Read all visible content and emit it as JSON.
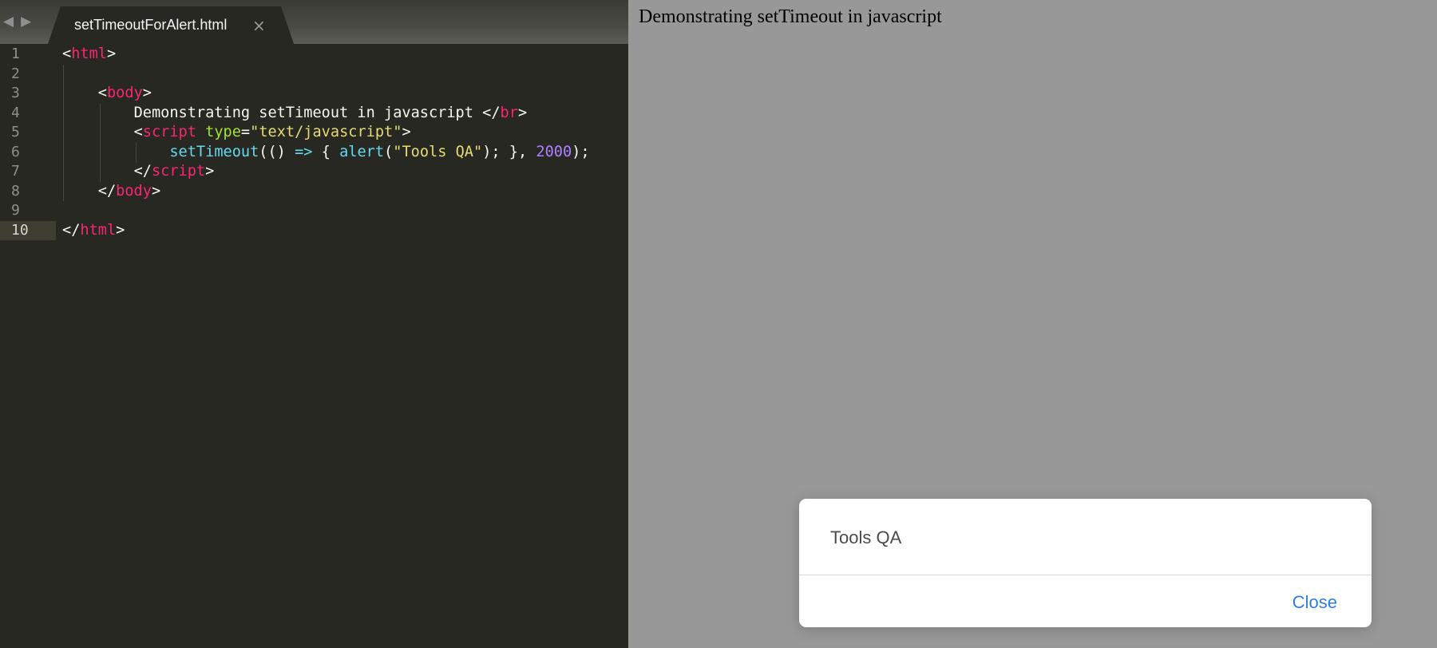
{
  "editor": {
    "nav": {
      "back_icon": "◀",
      "forward_icon": "▶"
    },
    "tab": {
      "title": "setTimeoutForAlert.html",
      "close_icon": "×"
    },
    "line_numbers": [
      "1",
      "2",
      "3",
      "4",
      "5",
      "6",
      "7",
      "8",
      "9",
      "10"
    ],
    "active_line": "10",
    "code": {
      "l1_open": "<",
      "l1_tag": "html",
      "l1_close": ">",
      "l3_indent": "    ",
      "l3_open": "<",
      "l3_tag": "body",
      "l3_close": ">",
      "l4_indent": "        ",
      "l4_text": "Demonstrating setTimeout in javascript ",
      "l4_open": "</",
      "l4_tag": "br",
      "l4_close": ">",
      "l5_indent": "        ",
      "l5_open": "<",
      "l5_tag": "script",
      "l5_sp": " ",
      "l5_attr": "type",
      "l5_eq": "=",
      "l5_str": "\"text/javascript\"",
      "l5_close": ">",
      "l6_indent": "            ",
      "l6_fn": "setTimeout",
      "l6_p1": "(() ",
      "l6_arrow": "=>",
      "l6_p2": " { ",
      "l6_fn2": "alert",
      "l6_p3": "(",
      "l6_str": "\"Tools QA\"",
      "l6_p4": "); }, ",
      "l6_num": "2000",
      "l6_p5": ");",
      "l7_indent": "        ",
      "l7_open": "</",
      "l7_tag": "script",
      "l7_close": ">",
      "l8_indent": "    ",
      "l8_open": "</",
      "l8_tag": "body",
      "l8_close": ">",
      "l10_open": "</",
      "l10_tag": "html",
      "l10_close": ">"
    }
  },
  "browser": {
    "page_text": "Demonstrating setTimeout in javascript",
    "alert": {
      "message": "Tools QA",
      "close_label": "Close"
    }
  },
  "colors": {
    "tag": "#f92672",
    "attr": "#a6e22e",
    "string": "#e6db74",
    "function": "#66d9ef",
    "number": "#ae81ff",
    "editor_bg": "#272822",
    "browser_bg": "#989898",
    "alert_link": "#2f7de1"
  }
}
